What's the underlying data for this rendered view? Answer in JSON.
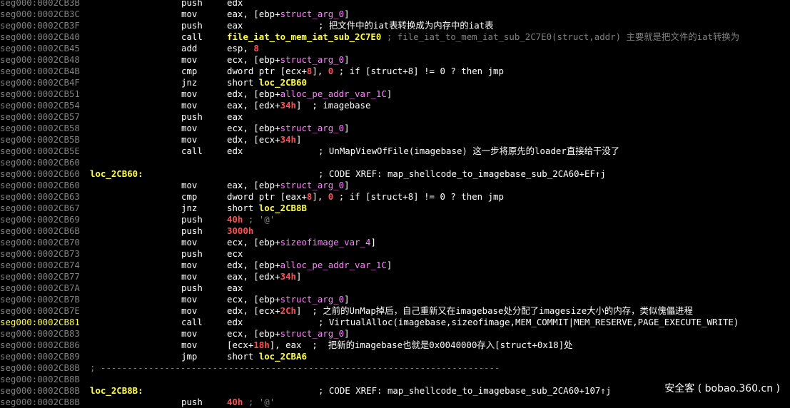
{
  "watermark": "安全客 ( bobao.360.cn )",
  "lines": [
    {
      "addr": "seg000:0002CB3B",
      "mnem": "push",
      "ops": [
        [
          "reg",
          "edx"
        ]
      ]
    },
    {
      "addr": "seg000:0002CB3C",
      "mnem": "mov",
      "ops": [
        [
          "reg",
          "eax, ["
        ],
        [
          "reg",
          "ebp"
        ],
        [
          "pl",
          "+"
        ],
        [
          "name",
          "struct_arg_0"
        ],
        [
          "pl",
          "]"
        ]
      ]
    },
    {
      "addr": "seg000:0002CB3F",
      "mnem": "push",
      "ops": [
        [
          "reg",
          "eax"
        ]
      ],
      "comment": "; 把文件中的iat表转换成为内存中的iat表"
    },
    {
      "addr": "seg000:0002CB40",
      "mnem": "call",
      "ops": [
        [
          "proc",
          "file_iat_to_mem_iat_sub_2C7E0"
        ],
        [
          "pl",
          " "
        ],
        [
          "dim",
          "; file_iat_to_mem_iat_sub_2C7E0(struct,addr) 主要就是把文件的iat转换为"
        ]
      ]
    },
    {
      "addr": "seg000:0002CB45",
      "mnem": "add",
      "ops": [
        [
          "reg",
          "esp, "
        ],
        [
          "num",
          "8"
        ]
      ]
    },
    {
      "addr": "seg000:0002CB48",
      "mnem": "mov",
      "ops": [
        [
          "reg",
          "ecx, ["
        ],
        [
          "reg",
          "ebp"
        ],
        [
          "pl",
          "+"
        ],
        [
          "name",
          "struct_arg_0"
        ],
        [
          "pl",
          "]"
        ]
      ]
    },
    {
      "addr": "seg000:0002CB4B",
      "mnem": "cmp",
      "ops": [
        [
          "reg",
          "dword ptr ["
        ],
        [
          "reg",
          "ecx"
        ],
        [
          "pl",
          "+"
        ],
        [
          "num",
          "8"
        ],
        [
          "pl",
          "], "
        ],
        [
          "num",
          "0"
        ],
        [
          "pl",
          " "
        ],
        [
          "cmt",
          "; if [struct+8] != 0 ? then jmp"
        ]
      ]
    },
    {
      "addr": "seg000:0002CB4F",
      "mnem": "jnz",
      "ops": [
        [
          "reg",
          "short "
        ],
        [
          "proc",
          "loc_2CB60"
        ]
      ]
    },
    {
      "addr": "seg000:0002CB51",
      "mnem": "mov",
      "ops": [
        [
          "reg",
          "edx, ["
        ],
        [
          "reg",
          "ebp"
        ],
        [
          "pl",
          "+"
        ],
        [
          "name",
          "alloc_pe_addr_var_1C"
        ],
        [
          "pl",
          "]"
        ]
      ]
    },
    {
      "addr": "seg000:0002CB54",
      "mnem": "mov",
      "ops": [
        [
          "reg",
          "eax, ["
        ],
        [
          "reg",
          "edx"
        ],
        [
          "pl",
          "+"
        ],
        [
          "num",
          "34h"
        ],
        [
          "pl",
          "]  "
        ],
        [
          "cmt",
          "; imagebase"
        ]
      ]
    },
    {
      "addr": "seg000:0002CB57",
      "mnem": "push",
      "ops": [
        [
          "reg",
          "eax"
        ]
      ]
    },
    {
      "addr": "seg000:0002CB58",
      "mnem": "mov",
      "ops": [
        [
          "reg",
          "ecx, ["
        ],
        [
          "reg",
          "ebp"
        ],
        [
          "pl",
          "+"
        ],
        [
          "name",
          "struct_arg_0"
        ],
        [
          "pl",
          "]"
        ]
      ]
    },
    {
      "addr": "seg000:0002CB5B",
      "mnem": "mov",
      "ops": [
        [
          "reg",
          "edx, ["
        ],
        [
          "reg",
          "ecx"
        ],
        [
          "pl",
          "+"
        ],
        [
          "num",
          "34h"
        ],
        [
          "pl",
          "]"
        ]
      ]
    },
    {
      "addr": "seg000:0002CB5E",
      "mnem": "call",
      "ops": [
        [
          "reg",
          "edx"
        ]
      ],
      "comment": "; UnMapViewOfFile(imagebase) 这一步将原先的loader直接给干没了"
    },
    {
      "addr": "seg000:0002CB60"
    },
    {
      "addr": "seg000:0002CB60",
      "label": "loc_2CB60:",
      "comment": "; CODE XREF: map_shellcode_to_imagebase_sub_2CA60+EF↑j",
      "xref": true
    },
    {
      "addr": "seg000:0002CB60",
      "mnem": "mov",
      "ops": [
        [
          "reg",
          "eax, ["
        ],
        [
          "reg",
          "ebp"
        ],
        [
          "pl",
          "+"
        ],
        [
          "name",
          "struct_arg_0"
        ],
        [
          "pl",
          "]"
        ]
      ]
    },
    {
      "addr": "seg000:0002CB63",
      "mnem": "cmp",
      "ops": [
        [
          "reg",
          "dword ptr ["
        ],
        [
          "reg",
          "eax"
        ],
        [
          "pl",
          "+"
        ],
        [
          "num",
          "8"
        ],
        [
          "pl",
          "], "
        ],
        [
          "num",
          "0"
        ],
        [
          "pl",
          " "
        ],
        [
          "cmt",
          "; if [struct+8] != 0 ? then jmp"
        ]
      ]
    },
    {
      "addr": "seg000:0002CB67",
      "mnem": "jnz",
      "ops": [
        [
          "reg",
          "short "
        ],
        [
          "proc",
          "loc_2CB8B"
        ]
      ]
    },
    {
      "addr": "seg000:0002CB69",
      "mnem": "push",
      "ops": [
        [
          "num",
          "40h"
        ],
        [
          "pl",
          " "
        ],
        [
          "dim",
          "; '@'"
        ]
      ]
    },
    {
      "addr": "seg000:0002CB6B",
      "mnem": "push",
      "ops": [
        [
          "num",
          "3000h"
        ]
      ]
    },
    {
      "addr": "seg000:0002CB70",
      "mnem": "mov",
      "ops": [
        [
          "reg",
          "ecx, ["
        ],
        [
          "reg",
          "ebp"
        ],
        [
          "pl",
          "+"
        ],
        [
          "name",
          "sizeofimage_var_4"
        ],
        [
          "pl",
          "]"
        ]
      ]
    },
    {
      "addr": "seg000:0002CB73",
      "mnem": "push",
      "ops": [
        [
          "reg",
          "ecx"
        ]
      ]
    },
    {
      "addr": "seg000:0002CB74",
      "mnem": "mov",
      "ops": [
        [
          "reg",
          "edx, ["
        ],
        [
          "reg",
          "ebp"
        ],
        [
          "pl",
          "+"
        ],
        [
          "name",
          "alloc_pe_addr_var_1C"
        ],
        [
          "pl",
          "]"
        ]
      ]
    },
    {
      "addr": "seg000:0002CB77",
      "mnem": "mov",
      "ops": [
        [
          "reg",
          "eax, ["
        ],
        [
          "reg",
          "edx"
        ],
        [
          "pl",
          "+"
        ],
        [
          "num",
          "34h"
        ],
        [
          "pl",
          "]"
        ]
      ]
    },
    {
      "addr": "seg000:0002CB7A",
      "mnem": "push",
      "ops": [
        [
          "reg",
          "eax"
        ]
      ]
    },
    {
      "addr": "seg000:0002CB7B",
      "mnem": "mov",
      "ops": [
        [
          "reg",
          "ecx, ["
        ],
        [
          "reg",
          "ebp"
        ],
        [
          "pl",
          "+"
        ],
        [
          "name",
          "struct_arg_0"
        ],
        [
          "pl",
          "]"
        ]
      ]
    },
    {
      "addr": "seg000:0002CB7E",
      "mnem": "mov",
      "ops": [
        [
          "reg",
          "edx, ["
        ],
        [
          "reg",
          "ecx"
        ],
        [
          "pl",
          "+"
        ],
        [
          "num",
          "2Ch"
        ],
        [
          "pl",
          "]  "
        ],
        [
          "cmt",
          "; 之前的UnMap掉后，自己重新又在imagebase处分配了imagesize大小的内存，类似傀儡进程"
        ]
      ]
    },
    {
      "addr": "seg000:0002CB81",
      "cur": true,
      "mnem": "call",
      "ops": [
        [
          "reg",
          "edx"
        ]
      ],
      "comment": "; VirtualAlloc(imagebase,sizeofimage,MEM_COMMIT|MEM_RESERVE,PAGE_EXECUTE_WRITE)"
    },
    {
      "addr": "seg000:0002CB83",
      "mnem": "mov",
      "ops": [
        [
          "reg",
          "ecx, ["
        ],
        [
          "reg",
          "ebp"
        ],
        [
          "pl",
          "+"
        ],
        [
          "name",
          "struct_arg_0"
        ],
        [
          "pl",
          "]"
        ]
      ]
    },
    {
      "addr": "seg000:0002CB86",
      "mnem": "mov",
      "ops": [
        [
          "pl",
          "["
        ],
        [
          "reg",
          "ecx"
        ],
        [
          "pl",
          "+"
        ],
        [
          "num",
          "18h"
        ],
        [
          "pl",
          "], eax  "
        ],
        [
          "cmt",
          ";  把新的imagebase也就是0x0040000存入[struct+0x18]处"
        ]
      ]
    },
    {
      "addr": "seg000:0002CB89",
      "mnem": "jmp",
      "ops": [
        [
          "reg",
          "short "
        ],
        [
          "proc",
          "loc_2CBA6"
        ]
      ]
    },
    {
      "addr": "seg000:0002CB8B",
      "sep": "; ---------------------------------------------------------------------------"
    },
    {
      "addr": "seg000:0002CB8B"
    },
    {
      "addr": "seg000:0002CB8B",
      "label": "loc_2CB8B:",
      "comment": "; CODE XREF: map_shellcode_to_imagebase_sub_2CA60+107↑j",
      "xref": true
    },
    {
      "addr": "seg000:0002CB8B",
      "mnem": "push",
      "ops": [
        [
          "num",
          "40h"
        ],
        [
          "pl",
          " "
        ],
        [
          "dim",
          "; '@'"
        ]
      ]
    }
  ]
}
